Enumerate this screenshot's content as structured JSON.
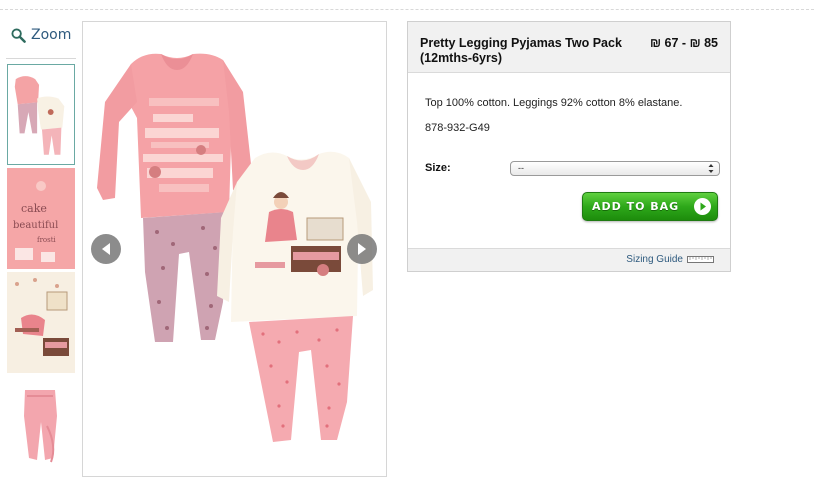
{
  "zoom": {
    "label": "Zoom",
    "icon": "magnifier-icon"
  },
  "thumbnails": [
    {
      "name": "outfit-set",
      "active": true
    },
    {
      "name": "print-detail",
      "active": false
    },
    {
      "name": "graphic-detail",
      "active": false
    },
    {
      "name": "leggings-detail",
      "active": false
    }
  ],
  "product": {
    "title": "Pretty Legging Pyjamas Two Pack (12mths-6yrs)",
    "price": "₪ 67 - ₪ 85",
    "description": "Top 100% cotton. Leggings 92% cotton 8% elastane.",
    "code": "878-932-G49",
    "size_label": "Size:",
    "size_selected": "--",
    "add_button": "ADD TO BAG",
    "sizing_guide": "Sizing Guide"
  },
  "colors": {
    "link": "#2e5a7e",
    "button_green": "#2ea81a",
    "pink": "#f2a0a6",
    "cream": "#fbf6ec"
  }
}
